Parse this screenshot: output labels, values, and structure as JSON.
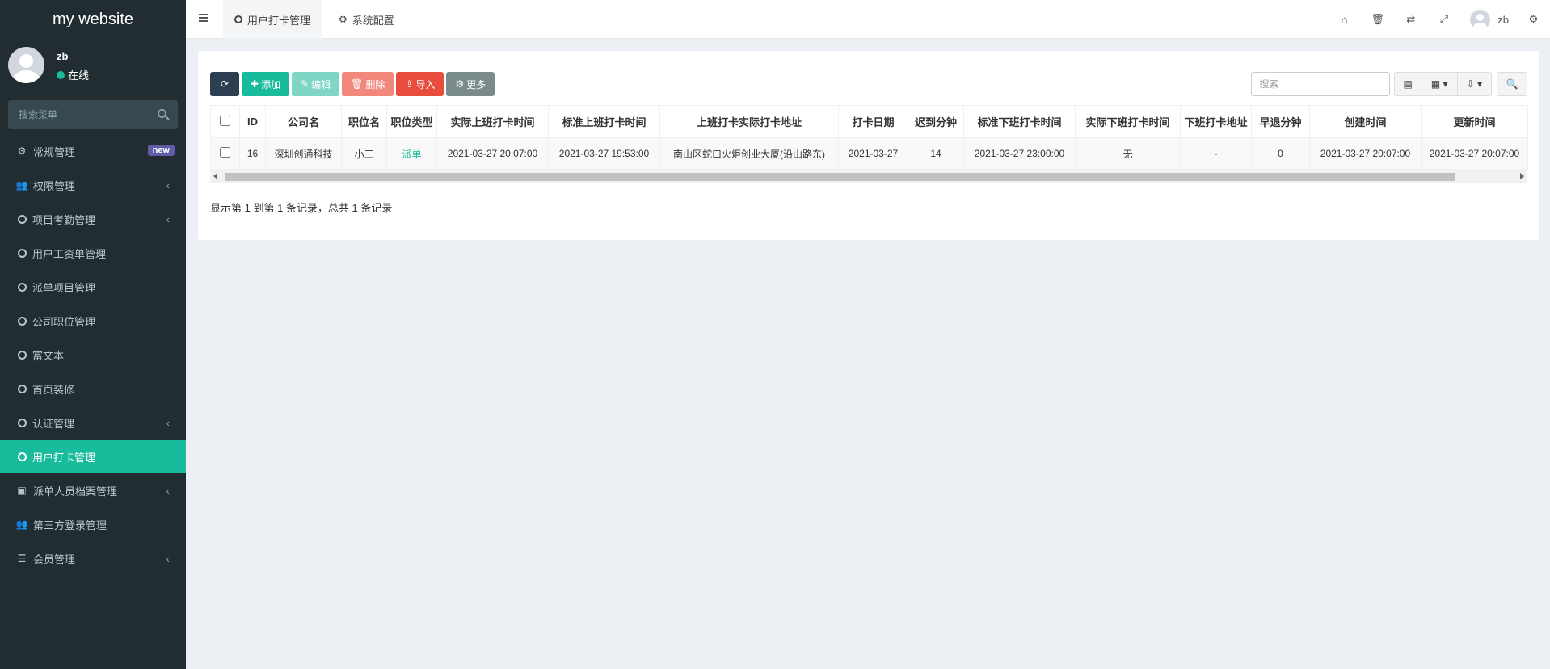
{
  "app": {
    "logo": "my website"
  },
  "user": {
    "name": "zb",
    "status": "在线"
  },
  "sidebar": {
    "search_placeholder": "搜索菜单",
    "items": [
      {
        "label": "常规管理",
        "icon": "cogs-icon",
        "badge": "new"
      },
      {
        "label": "权限管理",
        "icon": "group-icon",
        "chevron": "‹"
      },
      {
        "label": "项目考勤管理",
        "icon": "circle-icon",
        "chevron": "‹"
      },
      {
        "label": "用户工资单管理",
        "icon": "circle-icon"
      },
      {
        "label": "派单项目管理",
        "icon": "circle-icon"
      },
      {
        "label": "公司职位管理",
        "icon": "circle-icon"
      },
      {
        "label": "富文本",
        "icon": "circle-icon"
      },
      {
        "label": "首页装修",
        "icon": "circle-icon"
      },
      {
        "label": "认证管理",
        "icon": "circle-icon",
        "chevron": "‹"
      },
      {
        "label": "用户打卡管理",
        "icon": "circle-icon",
        "active": true
      },
      {
        "label": "派单人员档案管理",
        "icon": "address-book-icon",
        "chevron": "‹"
      },
      {
        "label": "第三方登录管理",
        "icon": "group-icon"
      },
      {
        "label": "会员管理",
        "icon": "list-icon",
        "chevron": "‹"
      }
    ]
  },
  "topbar": {
    "tabs": [
      {
        "label": "用户打卡管理",
        "active": true
      },
      {
        "label": "系统配置"
      }
    ],
    "user_name": "zb"
  },
  "toolbar": {
    "add": "添加",
    "edit": "编辑",
    "delete": "删除",
    "import": "导入",
    "more": "更多",
    "search_placeholder": "搜索"
  },
  "table": {
    "columns": [
      "ID",
      "公司名",
      "职位名",
      "职位类型",
      "实际上班打卡时间",
      "标准上班打卡时间",
      "上班打卡实际打卡地址",
      "打卡日期",
      "迟到分钟",
      "标准下班打卡时间",
      "实际下班打卡时间",
      "下班打卡地址",
      "早退分钟",
      "创建时间",
      "更新时间"
    ],
    "rows": [
      [
        "16",
        "深圳创通科技",
        "小三",
        "派单",
        "2021-03-27 20:07:00",
        "2021-03-27 19:53:00",
        "南山区蛇口火炬创业大厦(沿山路东)",
        "2021-03-27",
        "14",
        "2021-03-27 23:00:00",
        "无",
        "-",
        "0",
        "2021-03-27 20:07:00",
        "2021-03-27 20:07:00"
      ]
    ]
  },
  "pager": {
    "info": "显示第 1 到第 1 条记录，总共 1 条记录"
  },
  "colors": {
    "sidebar_bg": "#222d32",
    "accent": "#18bc9c",
    "primary_dark": "#2c3e50",
    "danger": "#e74c3c"
  }
}
